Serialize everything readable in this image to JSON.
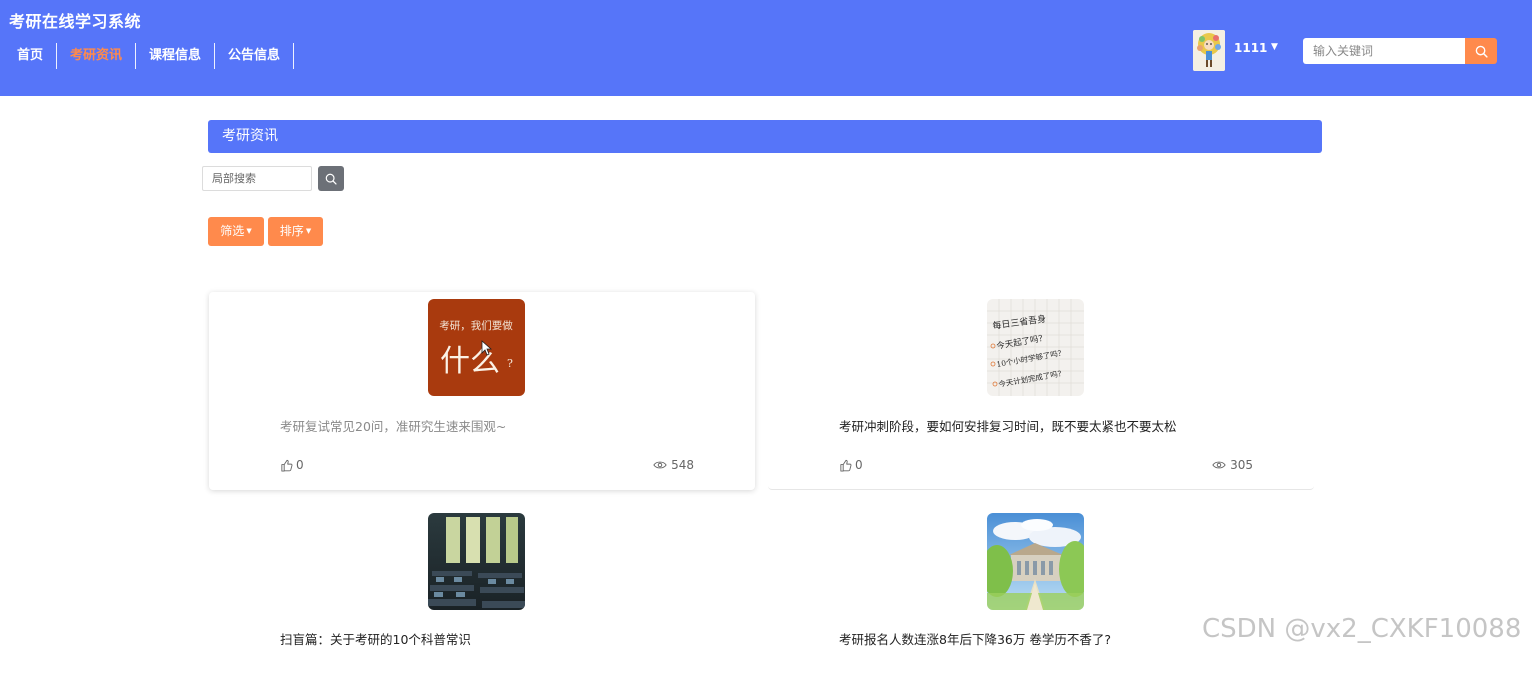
{
  "header": {
    "title": "考研在线学习系统",
    "nav": [
      {
        "label": "首页",
        "active": false
      },
      {
        "label": "考研资讯",
        "active": true
      },
      {
        "label": "课程信息",
        "active": false
      },
      {
        "label": "公告信息",
        "active": false
      }
    ],
    "username": "1111",
    "search_placeholder": "输入关键词",
    "accent_color": "#5675f9",
    "highlight_color": "#ff8a4c"
  },
  "main": {
    "section_title": "考研资讯",
    "local_search_placeholder": "局部搜索",
    "filter_label": "筛选",
    "sort_label": "排序"
  },
  "cards": [
    {
      "title": "考研复试常见20问，准研究生速来围观~",
      "likes": "0",
      "views": "548",
      "image_text_top": "考研，我们要做",
      "image_text_main": "什么",
      "image_text_q": "?"
    },
    {
      "title": "考研冲刺阶段，要如何安排复习时间，既不要太紧也不要太松",
      "likes": "0",
      "views": "305",
      "image_text_lines": [
        "每日三省吾身",
        "今天起了吗？",
        "10个小时学够了吗？",
        "今天计划完成了吗？"
      ]
    },
    {
      "title": "扫盲篇：关于考研的10个科普常识"
    },
    {
      "title": "考研报名人数连涨8年后下降36万 卷学历不香了?"
    }
  ],
  "watermark": "CSDN @vx2_CXKF10088"
}
